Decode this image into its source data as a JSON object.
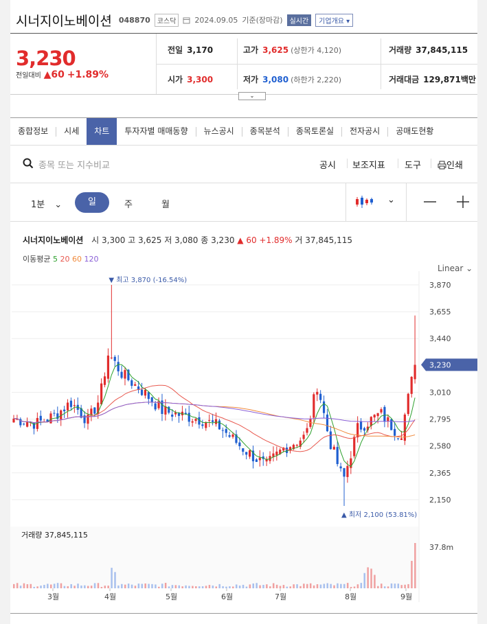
{
  "header": {
    "stock_name": "시너지이노베이션",
    "code": "048870",
    "market": "코스닥",
    "date": "2024.09.05",
    "date_note": "기준(장마감)",
    "realtime": "실시간",
    "company_overview": "기업개요"
  },
  "quote": {
    "price": "3,230",
    "change_label": "전일대비",
    "change": "60",
    "change_pct": "+1.89%",
    "prev_label": "전일",
    "prev": "3,170",
    "high_label": "고가",
    "high": "3,625",
    "upper_limit": "(상한가 4,120)",
    "volume_label": "거래량",
    "volume": "37,845,115",
    "open_label": "시가",
    "open": "3,300",
    "low_label": "저가",
    "low": "3,080",
    "lower_limit": "(하한가 2,220)",
    "value_label": "거래대금",
    "value": "129,871",
    "value_unit": "백만"
  },
  "tabs": [
    "종합정보",
    "시세",
    "차트",
    "투자자별 매매동향",
    "뉴스공시",
    "종목분석",
    "종목토론실",
    "전자공시",
    "공매도현황"
  ],
  "active_tab": "차트",
  "search": {
    "placeholder": "종목 또는 지수비교",
    "tools": [
      "공시",
      "보조지표",
      "도구",
      "인쇄"
    ]
  },
  "periods": {
    "minute": "1분",
    "day": "일",
    "week": "주",
    "month": "월"
  },
  "chart_info": {
    "name": "시너지이노베이션",
    "line": "시 3,300  고 3,625  저 3,080  종 3,230 ▲ 60 +1.89%  거 37,845,115",
    "ma_label": "이동평균",
    "ma_periods": [
      "5",
      "20",
      "60",
      "120"
    ],
    "ma_colors": [
      "#2ca02c",
      "#e8584e",
      "#f08a3c",
      "#8a5fd6"
    ],
    "scale": "Linear"
  },
  "chart_data": {
    "type": "candlestick",
    "y_ticks": [
      "3,870",
      "3,655",
      "3,440",
      "3,010",
      "2,795",
      "2,580",
      "2,365",
      "2,150"
    ],
    "ylim": [
      2100,
      3870
    ],
    "current_price_label": "3,230",
    "max_label": "최고 3,870 (-16.54%)",
    "min_label": "최저 2,100 (53.81%)",
    "x_ticks": [
      "3월",
      "4월",
      "5월",
      "6월",
      "7월",
      "8월",
      "9월"
    ],
    "volume_label": "거래량 37,845,115",
    "volume_tick": "37.8m",
    "up_color": "#e12c2c",
    "down_color": "#1f5fd0"
  }
}
